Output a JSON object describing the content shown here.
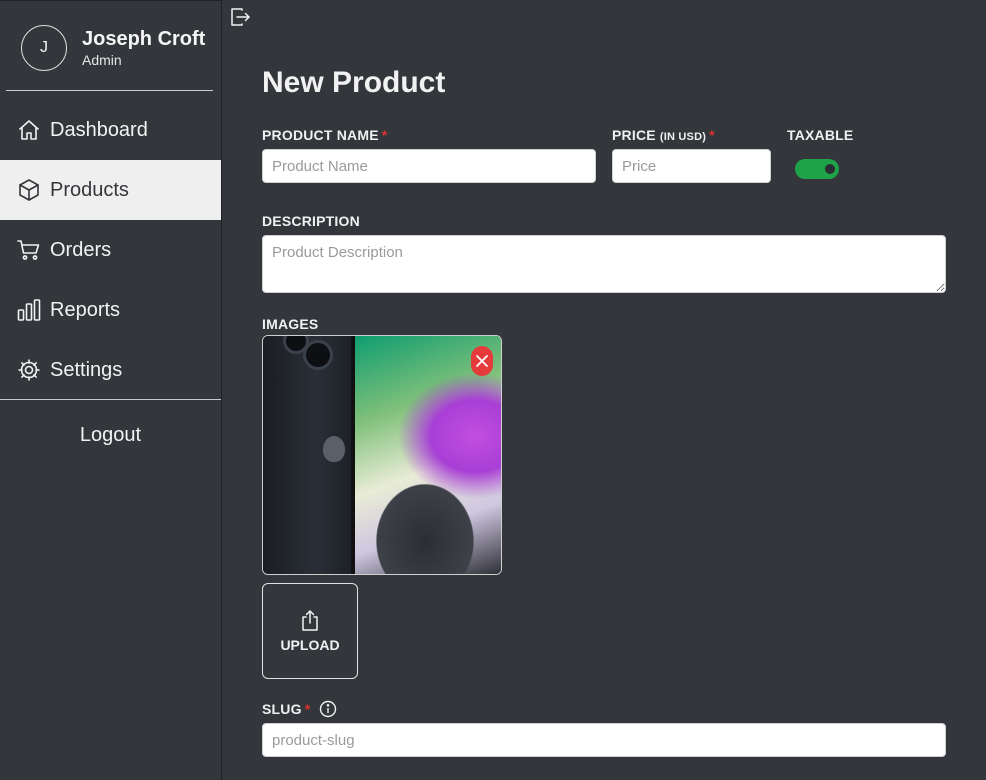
{
  "user": {
    "initial": "J",
    "name": "Joseph Croft",
    "role": "Admin"
  },
  "nav": {
    "items": [
      {
        "label": "Dashboard",
        "icon": "home-icon"
      },
      {
        "label": "Products",
        "icon": "box-icon",
        "active": true
      },
      {
        "label": "Orders",
        "icon": "cart-icon"
      },
      {
        "label": "Reports",
        "icon": "bar-chart-icon"
      },
      {
        "label": "Settings",
        "icon": "gear-icon"
      }
    ],
    "logout_label": "Logout"
  },
  "page": {
    "title": "New Product"
  },
  "form": {
    "product_name": {
      "label": "PRODUCT NAME",
      "required_mark": "*",
      "placeholder": "Product Name",
      "value": ""
    },
    "price": {
      "label": "PRICE",
      "unit": "(IN USD)",
      "required_mark": "*",
      "placeholder": "Price",
      "value": ""
    },
    "taxable": {
      "label": "TAXABLE",
      "checked": true
    },
    "description": {
      "label": "DESCRIPTION",
      "placeholder": "Product Description",
      "value": ""
    },
    "images": {
      "label": "IMAGES",
      "count": 1,
      "upload_label": "UPLOAD"
    },
    "slug": {
      "label": "SLUG",
      "required_mark": "*",
      "placeholder": "product-slug",
      "value": ""
    }
  },
  "colors": {
    "background": "#33363a",
    "active_nav_bg": "#efefef",
    "toggle_on": "#1fa34a",
    "required": "#e0312f",
    "remove_button": "#e53b3b"
  }
}
